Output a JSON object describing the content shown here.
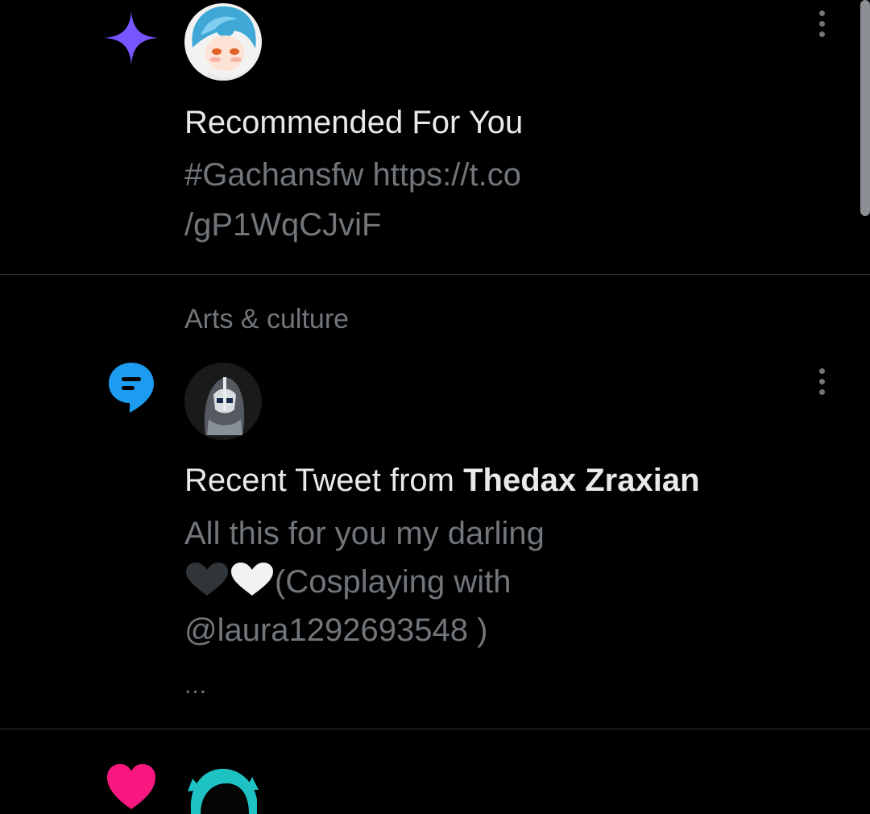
{
  "notifications": [
    {
      "type_icon": "sparkle-icon",
      "headline": "Recommended For You",
      "body": "#Gachansfw https://t.co/gP1WqCJviF",
      "body_line1": "#Gachansfw https://t.co",
      "body_line2": "/gP1WqCJviF"
    },
    {
      "category": "Arts & culture",
      "type_icon": "tweet-bubble-icon",
      "headline_prefix": "Recent Tweet from ",
      "author": "Thedax Zraxian",
      "body_line1": "All this for you my darling",
      "body_line2": "(Cosplaying with",
      "body_line3": "@laura1292693548 )",
      "ellipsis": "..."
    },
    {
      "type_icon": "heart-icon"
    }
  ],
  "colors": {
    "background": "#000000",
    "primary_text": "#e7e9ea",
    "secondary_text": "#71767b",
    "divider": "#2f3336",
    "sparkle": "#7856ff",
    "tweet_icon": "#1d9bf0",
    "like": "#f91880"
  }
}
